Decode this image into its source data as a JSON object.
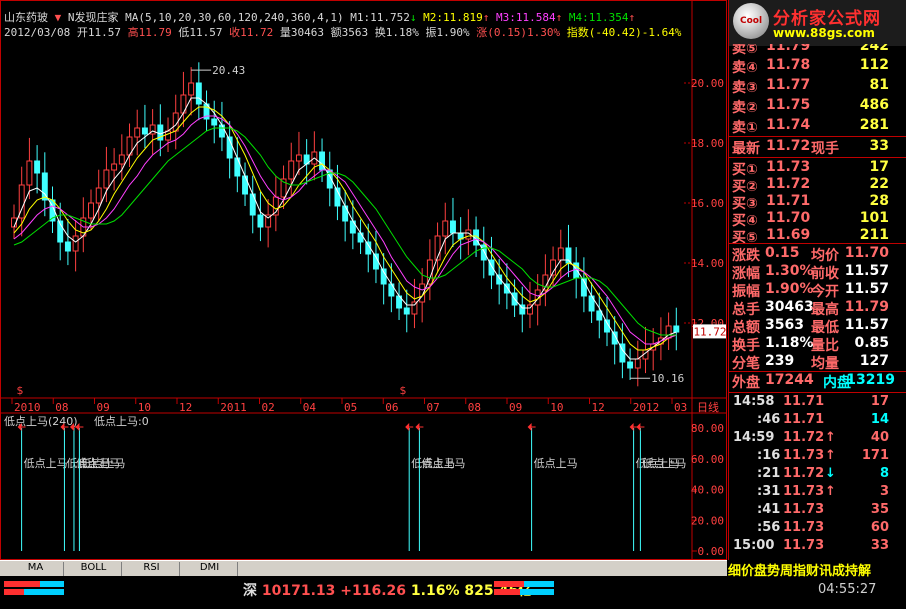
{
  "header": {
    "stock_name": "山东药玻",
    "indicator_name": "N发现庄家",
    "ma_params": "MA(5,10,20,30,60,120,240,360,4,1)",
    "m1": "M1:11.752",
    "m2": "M2:11.819",
    "m3": "M3:11.584",
    "m4": "M4:11.354",
    "date": "2012/03/08",
    "open": "开11.57",
    "high": "高11.79",
    "low": "低11.57",
    "close": "收11.72",
    "volume": "量30463",
    "amount": "额3563",
    "turnover": "换1.18%",
    "amplitude": "振1.90%",
    "change": "涨(0.15)1.30%",
    "index": "指数(-40.42)-1.64%"
  },
  "chart_data": {
    "type": "candlestick",
    "price_axis_ticks": [
      "20.00",
      "18.00",
      "16.00",
      "14.00",
      "12.00"
    ],
    "price_range": [
      9.5,
      21.5
    ],
    "current_price_label": "11.72",
    "annotations": {
      "high": "20.43",
      "low": "10.16"
    },
    "time_axis": [
      "2010",
      "08",
      "09",
      "10",
      "12",
      "2011",
      "02",
      "04",
      "05",
      "06",
      "07",
      "08",
      "09",
      "10",
      "12",
      "2012",
      "03"
    ],
    "time_axis_end_label": "日线",
    "indicator": {
      "title": "低点上马(240)",
      "value_label": "低点上马:0",
      "ticks": [
        "80.00",
        "60.00",
        "40.00",
        "20.00",
        "0.00"
      ],
      "signal_label": "低点上马",
      "signals": [
        {
          "t": 0.02
        },
        {
          "t": 0.083
        },
        {
          "t": 0.097
        },
        {
          "t": 0.105
        },
        {
          "t": 0.59
        },
        {
          "t": 0.605
        },
        {
          "t": 0.77
        },
        {
          "t": 0.92
        },
        {
          "t": 0.93
        }
      ]
    },
    "closes": [
      15.5,
      16.6,
      17.4,
      17.0,
      16.1,
      15.4,
      14.7,
      14.4,
      14.9,
      15.5,
      16.0,
      16.5,
      17.1,
      17.3,
      17.6,
      18.2,
      18.5,
      18.3,
      18.6,
      18.1,
      18.4,
      19.0,
      19.6,
      20.0,
      19.3,
      18.8,
      18.6,
      18.2,
      17.5,
      16.9,
      16.3,
      15.6,
      15.2,
      15.6,
      16.2,
      16.8,
      17.4,
      17.6,
      17.3,
      17.7,
      17.1,
      16.5,
      15.9,
      15.4,
      15.0,
      14.7,
      14.3,
      13.8,
      13.3,
      12.9,
      12.5,
      12.3,
      12.7,
      13.3,
      14.1,
      14.9,
      15.4,
      15.0,
      14.8,
      15.1,
      14.6,
      14.1,
      13.6,
      13.3,
      13.0,
      12.6,
      12.3,
      12.6,
      13.1,
      13.6,
      14.1,
      14.5,
      14.0,
      13.5,
      12.9,
      12.4,
      12.1,
      11.7,
      11.3,
      10.7,
      10.5,
      10.8,
      11.1,
      11.3,
      11.5,
      11.9,
      11.7
    ],
    "mas": [
      {
        "color": "#ffffff",
        "values": [
          15.2,
          15.8,
          16.4,
          16.5,
          16.3,
          15.9,
          15.3,
          14.9,
          14.7,
          14.9,
          15.3,
          15.8,
          16.4,
          16.8,
          17.1,
          17.6,
          18.0,
          18.2,
          18.4,
          18.3,
          18.4,
          18.6,
          19.0,
          19.5,
          19.5,
          19.3,
          19.0,
          18.6,
          18.1,
          17.5,
          16.9,
          16.3,
          15.7,
          15.5,
          15.7,
          16.1,
          16.6,
          17.1,
          17.3,
          17.5,
          17.3,
          16.9,
          16.4,
          15.9,
          15.4,
          15.0,
          14.6,
          14.2,
          13.7,
          13.3,
          12.9,
          12.6,
          12.6,
          12.9,
          13.5,
          14.2,
          14.8,
          15.0,
          15.0,
          15.0,
          14.8,
          14.4,
          13.9,
          13.5,
          13.2,
          12.8,
          12.5,
          12.5,
          12.8,
          13.2,
          13.7,
          14.1,
          14.1,
          13.8,
          13.4,
          12.9,
          12.5,
          12.0,
          11.6,
          11.1,
          10.8,
          10.8,
          11.0,
          11.2,
          11.4,
          11.6,
          11.7
        ]
      },
      {
        "color": "#ffff00",
        "values": [
          15.0,
          15.3,
          15.8,
          16.1,
          16.2,
          16.1,
          15.8,
          15.4,
          15.1,
          15.0,
          15.1,
          15.4,
          15.8,
          16.3,
          16.7,
          17.1,
          17.5,
          17.8,
          18.1,
          18.2,
          18.3,
          18.4,
          18.7,
          19.0,
          19.2,
          19.2,
          19.1,
          18.9,
          18.6,
          18.1,
          17.6,
          17.0,
          16.4,
          16.0,
          15.8,
          15.9,
          16.2,
          16.6,
          16.9,
          17.2,
          17.3,
          17.1,
          16.8,
          16.4,
          15.9,
          15.5,
          15.1,
          14.7,
          14.2,
          13.8,
          13.4,
          13.0,
          12.8,
          12.9,
          13.2,
          13.7,
          14.2,
          14.6,
          14.8,
          14.9,
          14.9,
          14.7,
          14.3,
          13.9,
          13.5,
          13.2,
          12.9,
          12.7,
          12.8,
          13.0,
          13.4,
          13.8,
          14.0,
          13.9,
          13.7,
          13.3,
          12.9,
          12.5,
          12.1,
          11.7,
          11.3,
          11.1,
          11.1,
          11.2,
          11.3,
          11.5,
          11.6
        ]
      },
      {
        "color": "#ff40ff",
        "values": [
          14.8,
          15.0,
          15.3,
          15.6,
          15.8,
          15.9,
          15.8,
          15.6,
          15.4,
          15.2,
          15.2,
          15.3,
          15.5,
          15.8,
          16.2,
          16.6,
          16.9,
          17.3,
          17.6,
          17.8,
          18.0,
          18.1,
          18.3,
          18.6,
          18.8,
          18.9,
          18.9,
          18.8,
          18.6,
          18.3,
          17.9,
          17.4,
          16.9,
          16.5,
          16.2,
          16.1,
          16.2,
          16.4,
          16.7,
          16.9,
          17.1,
          17.1,
          16.9,
          16.7,
          16.3,
          15.9,
          15.5,
          15.1,
          14.7,
          14.2,
          13.8,
          13.4,
          13.2,
          13.1,
          13.2,
          13.5,
          13.9,
          14.3,
          14.6,
          14.7,
          14.8,
          14.7,
          14.5,
          14.2,
          13.9,
          13.6,
          13.3,
          13.0,
          12.9,
          13.0,
          13.2,
          13.5,
          13.7,
          13.8,
          13.7,
          13.5,
          13.2,
          12.9,
          12.5,
          12.1,
          11.7,
          11.5,
          11.3,
          11.3,
          11.4,
          11.5,
          11.6
        ]
      },
      {
        "color": "#00e000",
        "values": [
          14.6,
          14.7,
          14.9,
          15.1,
          15.3,
          15.5,
          15.6,
          15.6,
          15.5,
          15.4,
          15.3,
          15.3,
          15.3,
          15.4,
          15.6,
          15.9,
          16.2,
          16.5,
          16.8,
          17.1,
          17.4,
          17.6,
          17.8,
          18.0,
          18.2,
          18.4,
          18.5,
          18.5,
          18.5,
          18.4,
          18.2,
          17.9,
          17.6,
          17.2,
          16.9,
          16.7,
          16.6,
          16.6,
          16.7,
          16.8,
          16.9,
          17.0,
          17.0,
          16.9,
          16.7,
          16.4,
          16.1,
          15.8,
          15.4,
          15.0,
          14.6,
          14.2,
          13.9,
          13.6,
          13.5,
          13.5,
          13.6,
          13.8,
          14.0,
          14.2,
          14.4,
          14.5,
          14.5,
          14.4,
          14.2,
          14.0,
          13.8,
          13.5,
          13.3,
          13.2,
          13.2,
          13.3,
          13.4,
          13.5,
          13.5,
          13.5,
          13.4,
          13.2,
          12.9,
          12.6,
          12.3,
          12.0,
          11.8,
          11.7,
          11.6,
          11.6,
          11.6
        ]
      }
    ]
  },
  "right_panel": {
    "logo_badge": "Cool",
    "logo_name": "分析家公式网",
    "logo_url": "www.88gs.com",
    "top_row": {
      "label": "卖⑤",
      "price": "11.79",
      "vol": "242"
    },
    "asks": [
      {
        "label": "卖④",
        "price": "11.78",
        "vol": "112"
      },
      {
        "label": "卖③",
        "price": "11.77",
        "vol": "81"
      },
      {
        "label": "卖②",
        "price": "11.75",
        "vol": "486"
      },
      {
        "label": "卖①",
        "price": "11.74",
        "vol": "281"
      }
    ],
    "latest": {
      "label": "最新",
      "price": "11.72",
      "hand_label": "现手",
      "hand": "33"
    },
    "bids": [
      {
        "label": "买①",
        "price": "11.73",
        "vol": "17"
      },
      {
        "label": "买②",
        "price": "11.72",
        "vol": "22"
      },
      {
        "label": "买③",
        "price": "11.71",
        "vol": "28"
      },
      {
        "label": "买④",
        "price": "11.70",
        "vol": "101"
      },
      {
        "label": "买⑤",
        "price": "11.69",
        "vol": "211"
      }
    ],
    "stats": [
      {
        "l1": "涨跌",
        "v1": "0.15",
        "l2": "均价",
        "v2": "11.70"
      },
      {
        "l1": "涨幅",
        "v1": "1.30%",
        "l2": "前收",
        "v2": "11.57"
      },
      {
        "l1": "振幅",
        "v1": "1.90%",
        "l2": "今开",
        "v2": "11.57"
      },
      {
        "l1": "总手",
        "v1": "30463",
        "l2": "最高",
        "v2": "11.79"
      },
      {
        "l1": "总额",
        "v1": "3563",
        "l2": "最低",
        "v2": "11.57"
      },
      {
        "l1": "换手",
        "v1": "1.18%",
        "l2": "量比",
        "v2": "0.85"
      },
      {
        "l1": "分笔",
        "v1": "239",
        "l2": "均量",
        "v2": "127"
      }
    ],
    "outer_inner": {
      "outer_label": "外盘",
      "outer": "17244",
      "inner_label": "内盘",
      "inner": "13219"
    },
    "ticks": [
      {
        "time": "14:58",
        "price": "11.71",
        "arrow": "",
        "vol": "17",
        "vc": "#ff6a6a"
      },
      {
        "time": ":46",
        "price": "11.71",
        "arrow": "",
        "vol": "14",
        "vc": "#00ffff"
      },
      {
        "time": "14:59",
        "price": "11.72",
        "arrow": "↑",
        "vol": "40",
        "vc": "#ff6a6a"
      },
      {
        "time": ":16",
        "price": "11.73",
        "arrow": "↑",
        "vol": "171",
        "vc": "#ff6a6a"
      },
      {
        "time": ":21",
        "price": "11.72",
        "arrow": "↓",
        "vol": "8",
        "vc": "#00ffff"
      },
      {
        "time": ":31",
        "price": "11.73",
        "arrow": "↑",
        "vol": "3",
        "vc": "#ff6a6a"
      },
      {
        "time": ":41",
        "price": "11.73",
        "arrow": "",
        "vol": "35",
        "vc": "#ff6a6a"
      },
      {
        "time": ":56",
        "price": "11.73",
        "arrow": "",
        "vol": "60",
        "vc": "#ff6a6a"
      },
      {
        "time": "15:00",
        "price": "11.73",
        "arrow": "",
        "vol": "33",
        "vc": "#ff6a6a"
      }
    ],
    "bottom_tabs": "细价盘势周指财讯成持解"
  },
  "tabs": [
    "MA",
    "BOLL",
    "RSI",
    "DMI"
  ],
  "ticker": {
    "market": "深",
    "index": "10171.13",
    "change": "+116.26",
    "pct": "1.16%",
    "amount": "825.46亿"
  },
  "clock": "04:55:27"
}
